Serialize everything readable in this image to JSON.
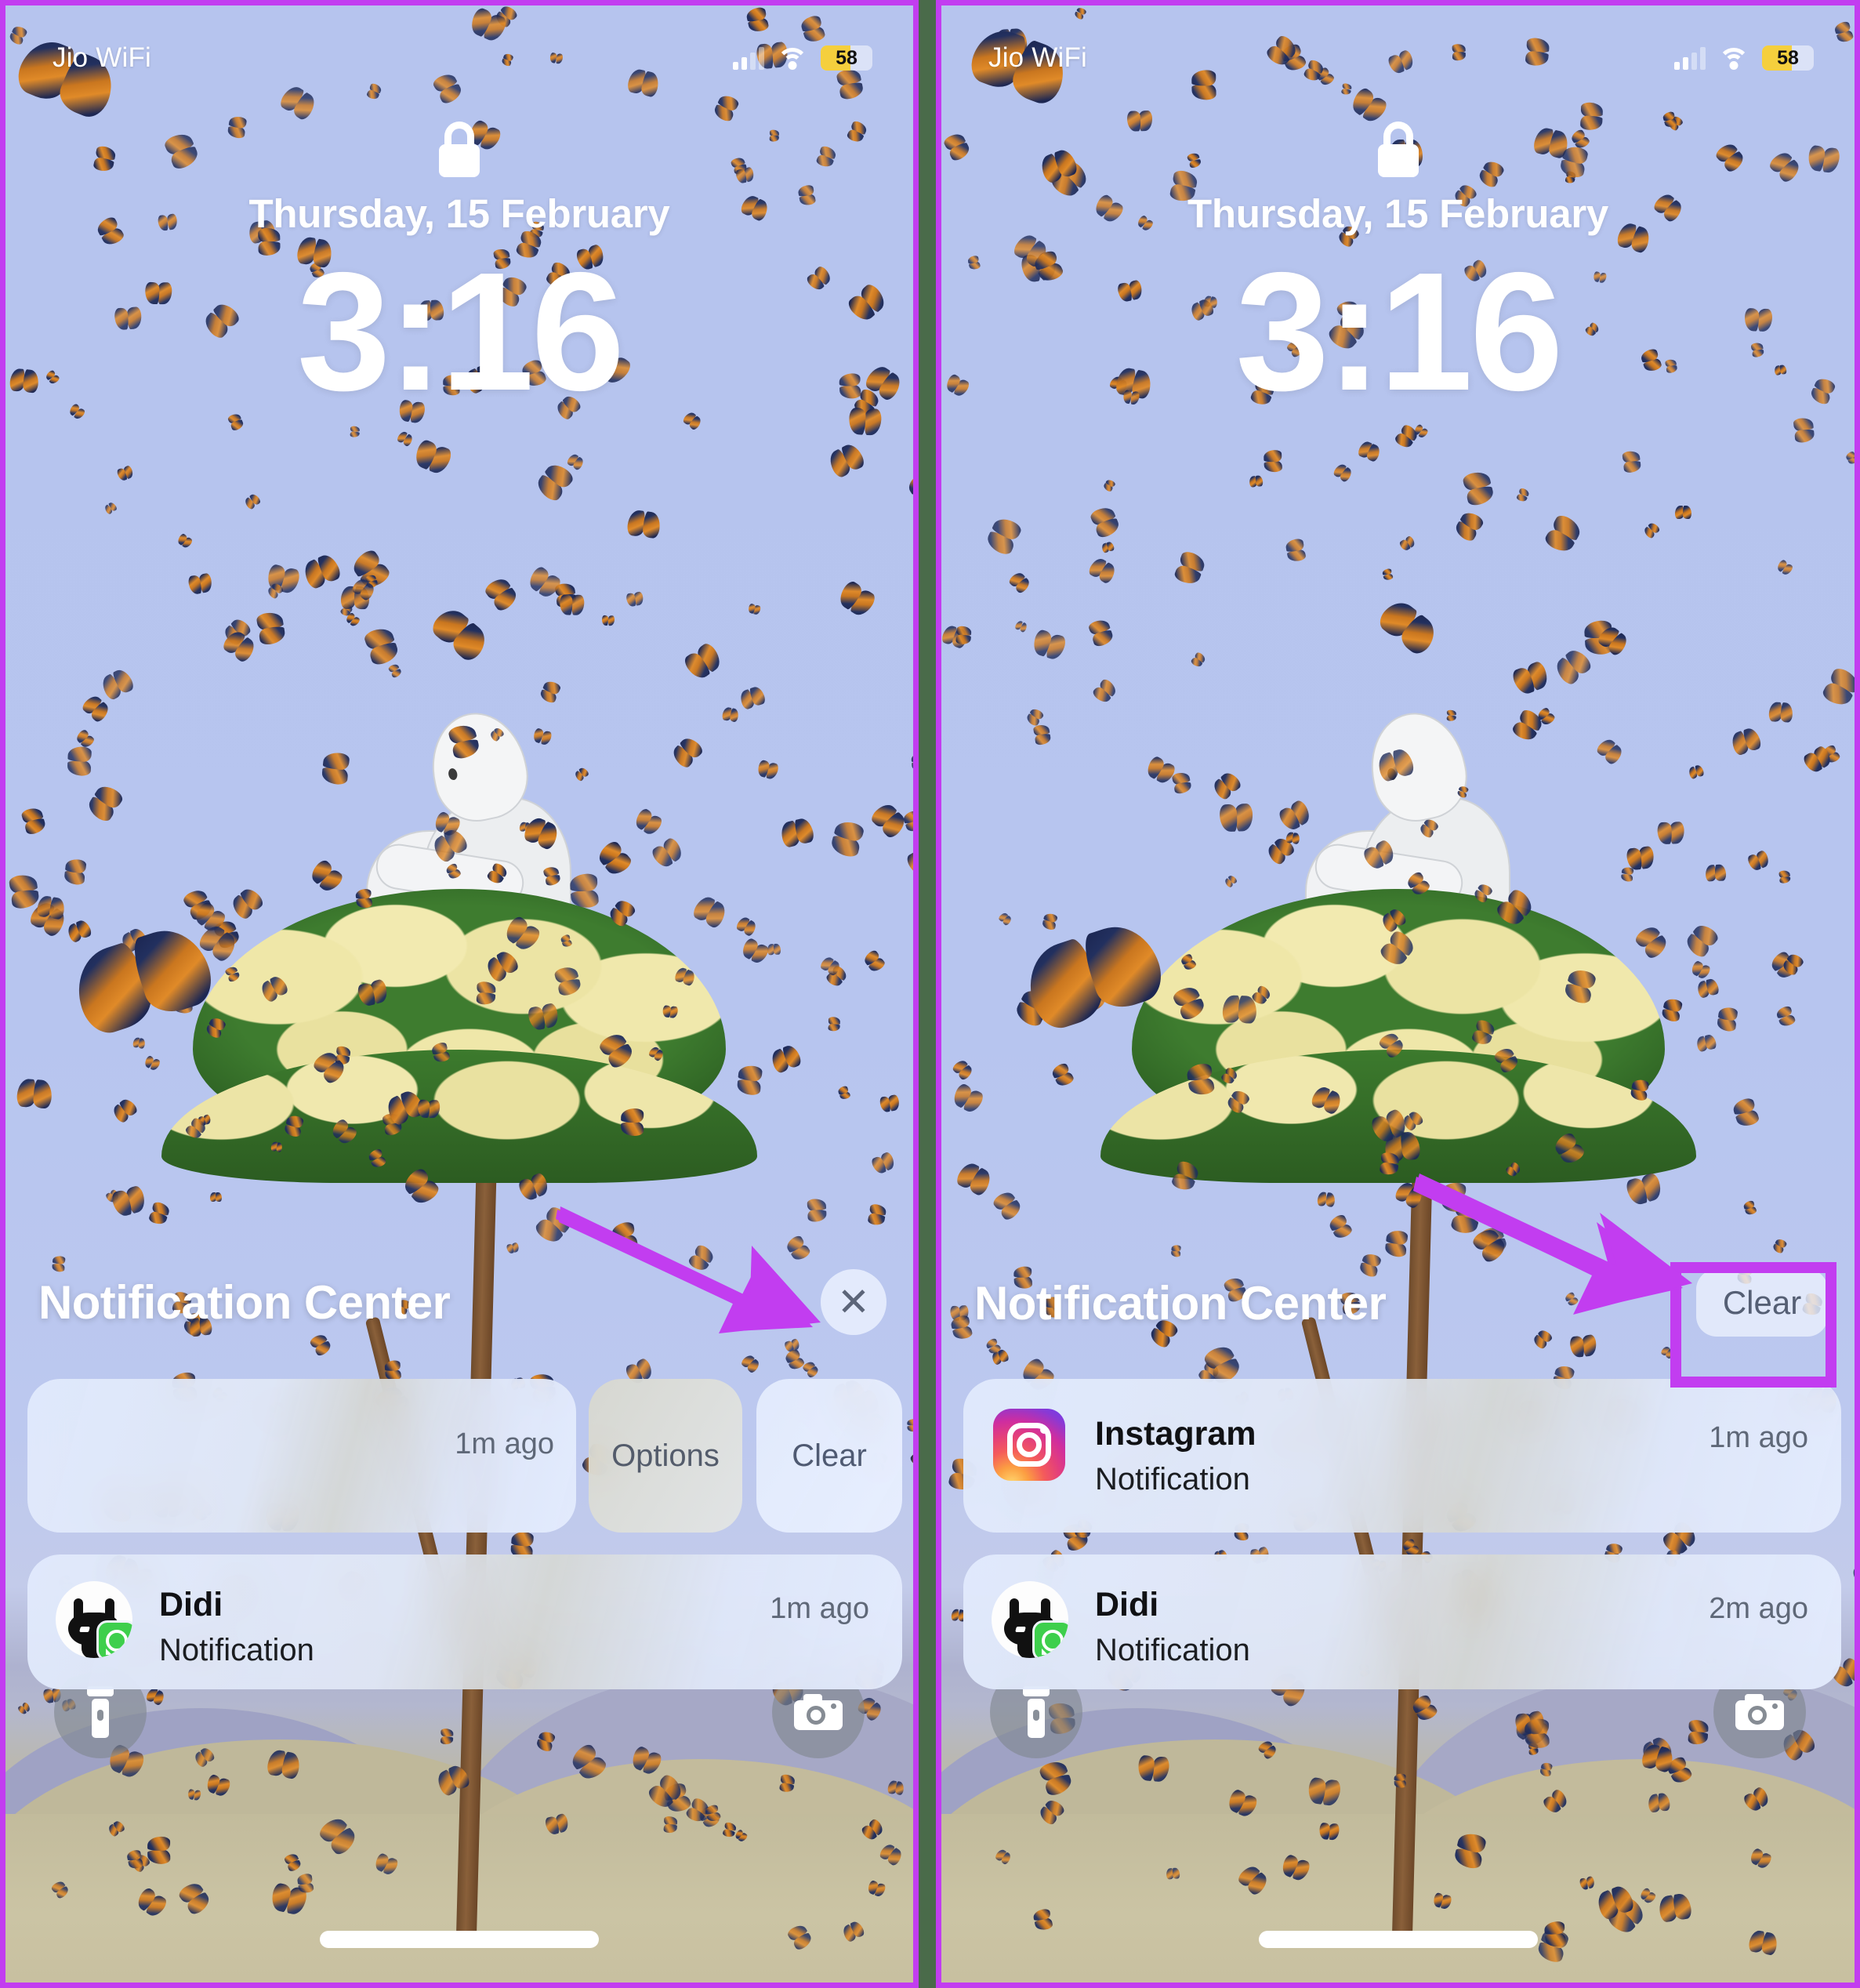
{
  "meta": {
    "accent_purple": "#c23df0",
    "divider_color": "#4a6b4a",
    "battery_fill": "#f5cf3d"
  },
  "status_bar": {
    "carrier": "Jio WiFi",
    "battery_level": "58",
    "signal_icon": "cellular-bars-icon",
    "wifi_icon": "wifi-icon",
    "battery_icon": "battery-low-power-icon"
  },
  "lock_screen": {
    "lock_icon": "lock-icon",
    "date": "Thursday, 15 February",
    "time": "3:16"
  },
  "notification_center": {
    "title": "Notification Center",
    "close_label": "✕",
    "clear_label": "Clear"
  },
  "panels": [
    {
      "id": "left",
      "header": {
        "title": "Notification Center",
        "button_type": "close",
        "button_label": "✕"
      },
      "notifications": [
        {
          "id": "swiped-row",
          "state": "swiped",
          "time": "1m ago",
          "actions": [
            {
              "label": "Options",
              "name": "options-button"
            },
            {
              "label": "Clear",
              "name": "clear-button"
            }
          ]
        },
        {
          "id": "didi-row",
          "state": "normal",
          "icon": "whatsapp-contact-avatar",
          "app": "Didi",
          "body": "Notification",
          "time": "1m ago"
        }
      ]
    },
    {
      "id": "right",
      "header": {
        "title": "Notification Center",
        "button_type": "clear",
        "button_label": "Clear",
        "highlighted": true
      },
      "notifications": [
        {
          "id": "instagram-row",
          "state": "normal",
          "icon": "instagram-icon",
          "app": "Instagram",
          "body": "Notification",
          "time": "1m ago"
        },
        {
          "id": "didi-row",
          "state": "normal",
          "icon": "whatsapp-contact-avatar",
          "app": "Didi",
          "body": "Notification",
          "time": "2m ago"
        }
      ]
    }
  ],
  "quick_actions": {
    "flashlight_icon": "flashlight-icon",
    "camera_icon": "camera-icon",
    "home_indicator": "home-indicator"
  },
  "annotations": {
    "arrow_color": "#c23df0",
    "left_arrow_target": "close-button",
    "right_arrow_target": "clear-button",
    "highlight_target": "clear-button"
  }
}
